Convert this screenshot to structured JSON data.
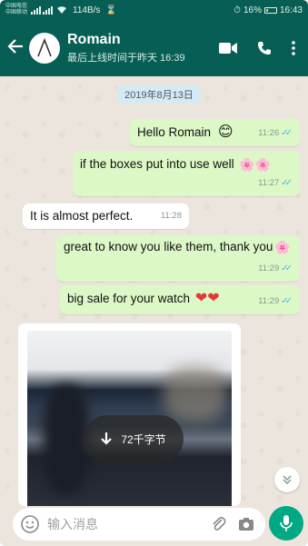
{
  "status_bar": {
    "carrier_top": "中国电信",
    "carrier_bottom": "中国移动",
    "net_speed": "114B/s",
    "hourglass": "⌛",
    "alarm": "⏱",
    "battery": "16%",
    "battery_level": 0.16,
    "time": "16:43"
  },
  "header": {
    "back_icon": "arrow-left-icon",
    "name": "Romain",
    "last_seen": "最后上线时间于昨天 16:39",
    "icons": [
      "video-call-icon",
      "voice-call-icon",
      "more-vert-icon"
    ]
  },
  "chat": {
    "date": "2019年8月13日",
    "messages": [
      {
        "dir": "out",
        "text": "Hello Romain",
        "emoji": "😊",
        "time": "11:26",
        "read": true
      },
      {
        "dir": "out",
        "text": "if the boxes put into use well",
        "emoji": "🌸🌸",
        "time": "11:27",
        "read": true
      },
      {
        "dir": "in",
        "text": "It is almost perfect.",
        "time": "11:28"
      },
      {
        "dir": "out",
        "text": "great to know you like them, thank you",
        "emoji": "🌸",
        "time": "11:29",
        "read": true
      },
      {
        "dir": "out",
        "text": "big sale for your watch",
        "emoji": "❤❤",
        "time": "11:29",
        "read": true
      }
    ],
    "media": {
      "download_icon": "download-arrow-icon",
      "size": "72千字节"
    },
    "scroll_icon": "double-chevron-down-icon"
  },
  "input_bar": {
    "placeholder": "输入消息",
    "icons": [
      "emoji-icon",
      "attach-clip-icon",
      "camera-icon",
      "mic-icon"
    ]
  },
  "colors": {
    "header": "#075e54",
    "outgoing_bubble": "#dcf8c6",
    "incoming_bubble": "#ffffff",
    "chat_bg": "#ece5dd",
    "read_tick": "#4fb6ec",
    "mic_button": "#00a884"
  }
}
